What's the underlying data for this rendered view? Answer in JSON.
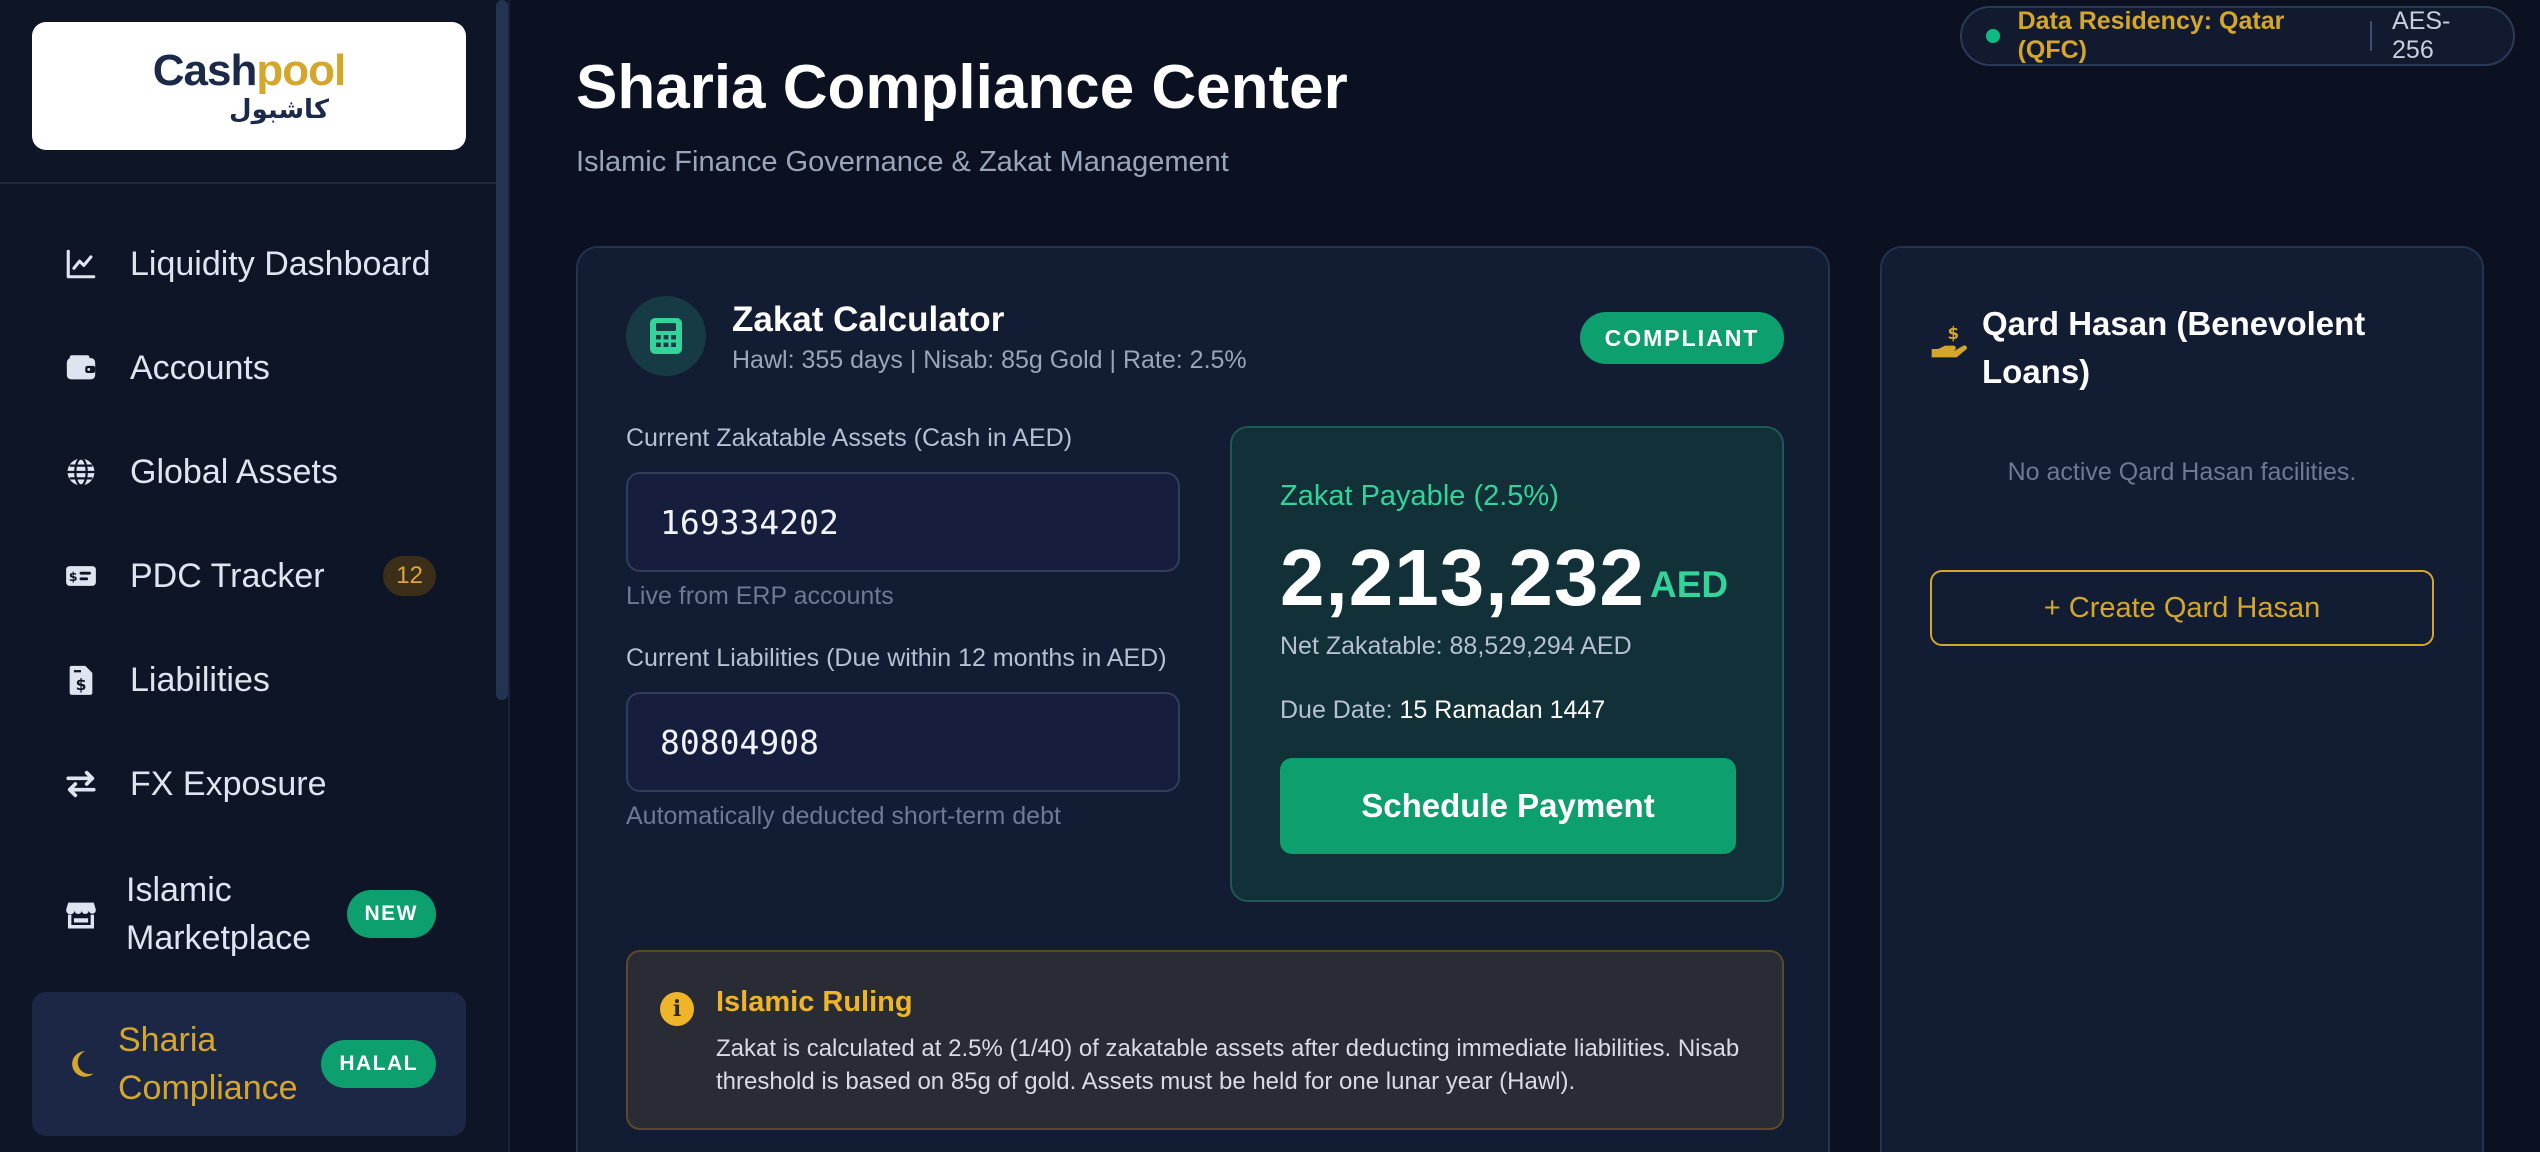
{
  "brand": {
    "logo_latin_part1": "Cash",
    "logo_latin_part2": "pool",
    "logo_arabic": "كاشبول",
    "colors": {
      "navy": "#1c2a4a",
      "gold": "#d4a72c"
    }
  },
  "sidebar": {
    "items": [
      {
        "label": "Liquidity Dashboard",
        "icon": "chart-line-icon"
      },
      {
        "label": "Accounts",
        "icon": "wallet-icon"
      },
      {
        "label": "Global Assets",
        "icon": "globe-icon"
      },
      {
        "label": "PDC Tracker",
        "icon": "money-check-icon",
        "badge": "12"
      },
      {
        "label": "Liabilities",
        "icon": "invoice-dollar-icon"
      },
      {
        "label": "FX Exposure",
        "icon": "exchange-arrows-icon"
      },
      {
        "label": "Islamic Marketplace",
        "icon": "store-icon",
        "badge": "NEW"
      },
      {
        "label": "Sharia Compliance",
        "icon": "crescent-moon-icon",
        "badge": "HALAL",
        "active": true
      }
    ]
  },
  "header": {
    "title": "Sharia Compliance Center",
    "subtitle": "Islamic Finance Governance & Zakat Management",
    "residency": "Data Residency: Qatar (QFC)",
    "encryption": "AES-256"
  },
  "zakat": {
    "title": "Zakat Calculator",
    "subtitle": "Hawl: 355 days | Nisab: 85g Gold | Rate: 2.5%",
    "status": "COMPLIANT",
    "assets_label": "Current Zakatable Assets (Cash in AED)",
    "assets_value": "169334202",
    "assets_hint": "Live from ERP accounts",
    "liabilities_label": "Current Liabilities (Due within 12 months in AED)",
    "liabilities_value": "80804908",
    "liabilities_hint": "Automatically deducted short-term debt",
    "payable_label": "Zakat Payable (2.5%)",
    "payable_amount": "2,213,232",
    "payable_currency": "AED",
    "net_zakatable": "Net Zakatable: 88,529,294 AED",
    "due_label": "Due Date:",
    "due_value": "15 Ramadan 1447",
    "schedule_button": "Schedule Payment",
    "ruling_title": "Islamic Ruling",
    "ruling_text": "Zakat is calculated at 2.5% (1/40) of zakatable assets after deducting immediate liabilities. Nisab threshold is based on 85g of gold. Assets must be held for one lunar year (Hawl).",
    "colors": {
      "accent": "#0e9f6e",
      "accent_text": "#34d399",
      "warning": "#f0b429"
    }
  },
  "qard": {
    "title": "Qard Hasan (Benevolent Loans)",
    "empty_text": "No active Qard Hasan facilities.",
    "create_button": "+ Create Qard Hasan",
    "icon": "hand-holding-dollar-icon"
  }
}
